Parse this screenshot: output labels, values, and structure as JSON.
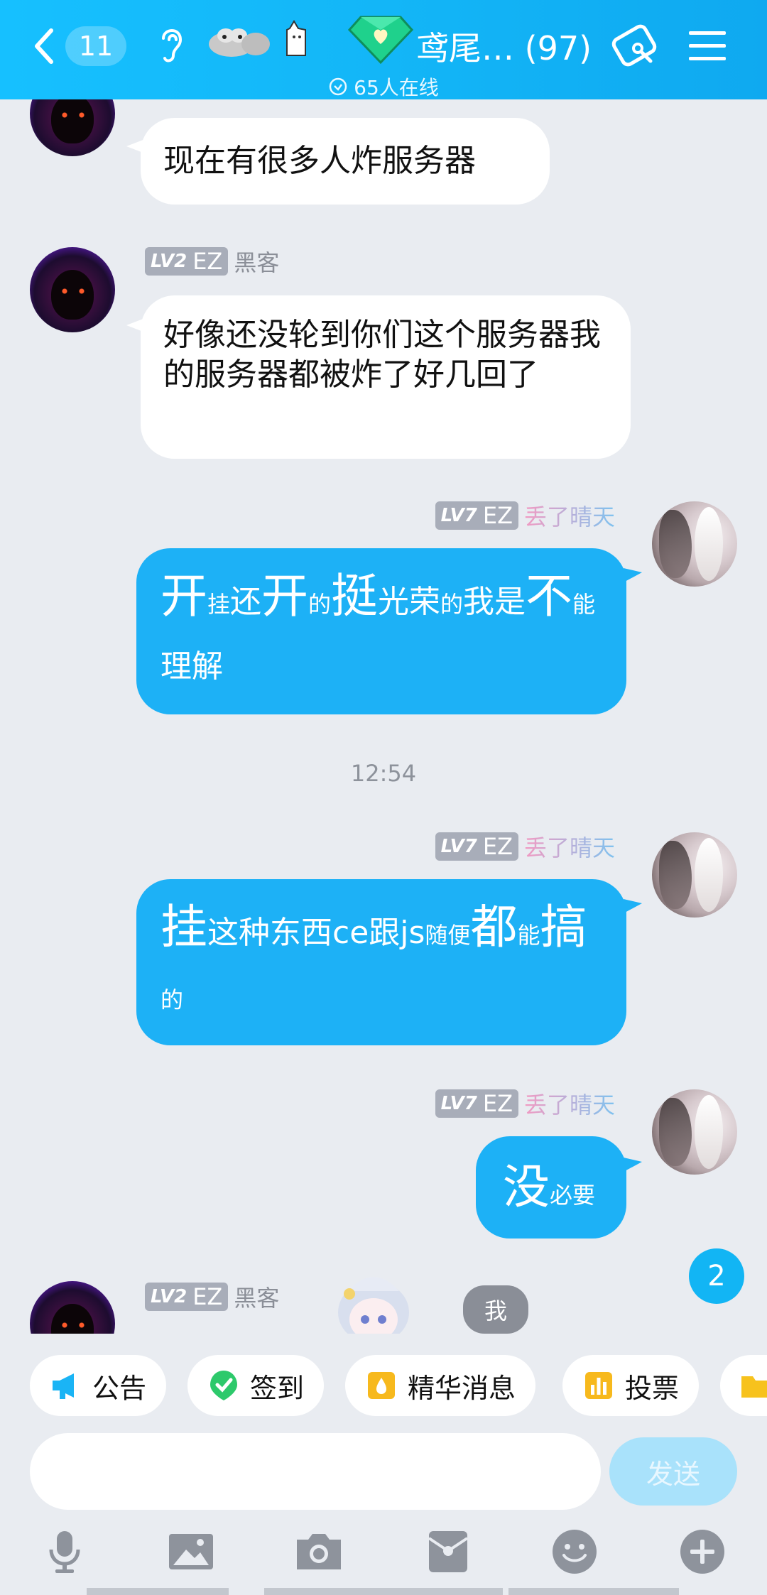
{
  "header": {
    "unread_count": "11",
    "group_title": "鸢尾…",
    "member_count": "(97)",
    "online_text": "65人在线"
  },
  "users": {
    "hacker": {
      "level": "LV2",
      "tag": "EZ",
      "role": "黑客"
    },
    "me": {
      "level": "LV7",
      "tag": "EZ",
      "name": "丢了晴天"
    }
  },
  "messages": {
    "m1": "现在有很多人炸服务器",
    "m2": "好像还没轮到你们这个服务器我的服务器都被炸了好几回了",
    "m3": [
      {
        "t": "开",
        "s": "big"
      },
      {
        "t": "挂",
        "s": "small"
      },
      {
        "t": "还",
        "s": "mid"
      },
      {
        "t": "开",
        "s": "big"
      },
      {
        "t": "的",
        "s": "small"
      },
      {
        "t": "挺",
        "s": "big"
      },
      {
        "t": "光荣",
        "s": "mid"
      },
      {
        "t": "的",
        "s": "small"
      },
      {
        "t": "我是",
        "s": "mid"
      },
      {
        "t": "不",
        "s": "big"
      },
      {
        "t": "能",
        "s": "small"
      },
      {
        "t": "理解",
        "s": "mid"
      }
    ],
    "time": "12:54",
    "m4": [
      {
        "t": "挂",
        "s": "big"
      },
      {
        "t": "这种东西ce跟js",
        "s": "mid"
      },
      {
        "t": "随便",
        "s": "small"
      },
      {
        "t": "都",
        "s": "big"
      },
      {
        "t": "能",
        "s": "small"
      },
      {
        "t": "搞",
        "s": "big"
      },
      {
        "t": "的",
        "s": "small"
      }
    ],
    "m5": [
      {
        "t": "没",
        "s": "big"
      },
      {
        "t": "必要",
        "s": "small"
      }
    ],
    "me_chip": "我",
    "unread_new": "2"
  },
  "quick_actions": [
    {
      "label": "公告",
      "icon": "megaphone-icon"
    },
    {
      "label": "签到",
      "icon": "checkin-icon"
    },
    {
      "label": "精华消息",
      "icon": "essence-icon"
    },
    {
      "label": "投票",
      "icon": "vote-icon"
    }
  ],
  "input": {
    "placeholder": "",
    "send_label": "发送"
  },
  "toolbar": [
    "mic-icon",
    "image-icon",
    "camera-icon",
    "redpacket-icon",
    "emoji-icon",
    "plus-icon"
  ],
  "colors": {
    "header": "#13b6f7",
    "bubble_blue": "#1db1f6",
    "background": "#e9ecf1"
  }
}
